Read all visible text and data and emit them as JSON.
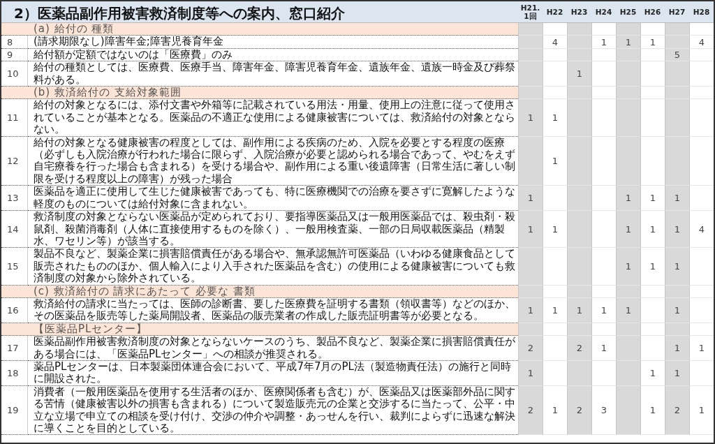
{
  "title": "2）医薬品副作用被害救済制度等への案内、窓口紹介",
  "columns": [
    {
      "label": "H21.\n1回",
      "shaded": true
    },
    {
      "label": "H22",
      "shaded": false
    },
    {
      "label": "H23",
      "shaded": true
    },
    {
      "label": "H24",
      "shaded": false
    },
    {
      "label": "H25",
      "shaded": true
    },
    {
      "label": "H26",
      "shaded": false
    },
    {
      "label": "H27",
      "shaded": true
    },
    {
      "label": "H28",
      "shaded": false
    }
  ],
  "rows": [
    {
      "kind": "section",
      "text": "(a) 給付の 種類"
    },
    {
      "kind": "item",
      "number": "8",
      "text": "(請求期限なし)障害年金;障害児養育年金",
      "cells": [
        {},
        {
          "value": "4"
        },
        {},
        {
          "value": "1"
        },
        {
          "value": "1"
        },
        {
          "value": "1"
        },
        {},
        {
          "value": "4"
        }
      ]
    },
    {
      "kind": "item",
      "number": "9",
      "text": "給付額が定額ではないのは「医療費」のみ",
      "cells": [
        {},
        {},
        {},
        {},
        {},
        {},
        {
          "value": "5"
        },
        {}
      ]
    },
    {
      "kind": "item",
      "number": "10",
      "text": "給付の種類としては、医療費、医療手当、障害年金、障害児養育年金、遺族年金、遺族一時金及び葬祭料がある。",
      "cells": [
        {},
        {},
        {
          "value": "1"
        },
        {},
        {},
        {},
        {},
        {}
      ]
    },
    {
      "kind": "section",
      "text": "(b) 救済給付の 支給対象範囲"
    },
    {
      "kind": "item",
      "number": "11",
      "text": "給付の対象となるには、添付文書や外箱等に記載されている用法・用量、使用上の注意に従って使用されていることが基本となる。医薬品の不適正な使用による健康被害については、救済給付の対象とならない。",
      "cells": [
        {
          "value": "1"
        },
        {
          "value": "1"
        },
        {},
        {},
        {},
        {},
        {},
        {}
      ]
    },
    {
      "kind": "item",
      "number": "12",
      "text": "給付の対象となる健康被害の程度としては、副作用による疾病のため、入院を必要とする程度の医療（必ずしも入院治療が行われた場合に限らず、入院治療が必要と認められる場合であって、やむをえず自宅療養を行った場合も含まれる）を受ける場合や、副作用による重い後遺障害（日常生活に著しい制限を受ける程度以上の障害）が残った場合",
      "cells": [
        {},
        {
          "value": "1"
        },
        {},
        {},
        {},
        {},
        {},
        {}
      ]
    },
    {
      "kind": "item",
      "number": "13",
      "text": "医薬品を適正に使用して生じた健康被害であっても、特に医療機関での治療を要さずに寛解したような軽度のものについては給付対象に含まれない。",
      "cells": [
        {
          "value": "1"
        },
        {},
        {},
        {},
        {
          "value": "1"
        },
        {
          "value": "1"
        },
        {
          "value": "1"
        },
        {}
      ]
    },
    {
      "kind": "item",
      "number": "14",
      "text": "救済制度の対象とならない医薬品が定められており、要指導医薬品又は一般用医薬品では、殺虫剤・殺鼠剤、殺菌消毒剤（人体に直接使用するものを除く）、一般用検査薬、一部の日局収載医薬品（精製水、ワセリン等）が該当する。",
      "cells": [
        {
          "value": "1"
        },
        {
          "value": "1"
        },
        {},
        {},
        {
          "value": "1"
        },
        {
          "value": "1"
        },
        {
          "value": "1"
        },
        {
          "value": "4"
        }
      ]
    },
    {
      "kind": "item",
      "number": "15",
      "text": "製品不良など、製薬企業に損害賠償責任がある場合や、無承認無許可医薬品（いわゆる健康食品として販売されたもののほか、個人輸入により入手された医薬品を含む）の使用による健康被害についても救済制度の対象から除外されている。",
      "cells": [
        {},
        {},
        {},
        {},
        {
          "value": "1"
        },
        {
          "value": "1"
        },
        {
          "value": "1"
        },
        {}
      ]
    },
    {
      "kind": "section",
      "text": "(c) 救済給付の 請求にあたって 必要な 書類"
    },
    {
      "kind": "item",
      "number": "16",
      "text": "救済給付の請求に当たっては、医師の診断書、要した医療費を証明する書類（領収書等）などのほか、その医薬品を販売等した薬局開設者、医薬品の販売業者の作成した販売証明書等が必要となる。",
      "cells": [
        {
          "value": "1"
        },
        {
          "value": "1"
        },
        {
          "value": "1"
        },
        {
          "value": "1"
        },
        {
          "value": "1"
        },
        {},
        {
          "value": "1"
        },
        {}
      ]
    },
    {
      "kind": "section",
      "text": "【医薬品PLセンター】"
    },
    {
      "kind": "item",
      "number": "17",
      "text": "医薬品副作用被害救済制度の対象とならないケースのうち、製品不良など、製薬企業に損害賠償責任がある場合には、「医薬品PLセンター」への相談が推奨される。",
      "cells": [
        {
          "value": "2"
        },
        {},
        {
          "value": "2"
        },
        {
          "value": "1"
        },
        {},
        {},
        {
          "value": "1"
        },
        {
          "value": "1"
        }
      ]
    },
    {
      "kind": "item",
      "number": "18",
      "text": "薬品PLセンターは、日本製薬団体連合会において、平成7年7月のPL法（製造物責任法）の施行と同時に開設された。",
      "cells": [
        {
          "value": "1"
        },
        {},
        {},
        {},
        {},
        {
          "value": "1"
        },
        {
          "value": "1"
        },
        {}
      ]
    },
    {
      "kind": "item",
      "number": "19",
      "text": "消費者（一般用医薬品を使用する生活者のほか、医療関係者も含む）が、医薬品又は医薬部外品に関する苦情（健康被害以外の損害も含まれる）について製造販売元の企業と交渉するに当たって、公平・中立な立場で申立ての相談を受け付け、交渉の仲介や調整・あっせんを行い、裁判によらずに迅速な解決に導くことを目的としている。",
      "cells": [
        {
          "value": "2"
        },
        {
          "value": "1"
        },
        {
          "value": "2"
        },
        {
          "value": "3"
        },
        {},
        {
          "value": "1"
        },
        {
          "value": "2"
        },
        {
          "value": "1"
        }
      ]
    }
  ]
}
